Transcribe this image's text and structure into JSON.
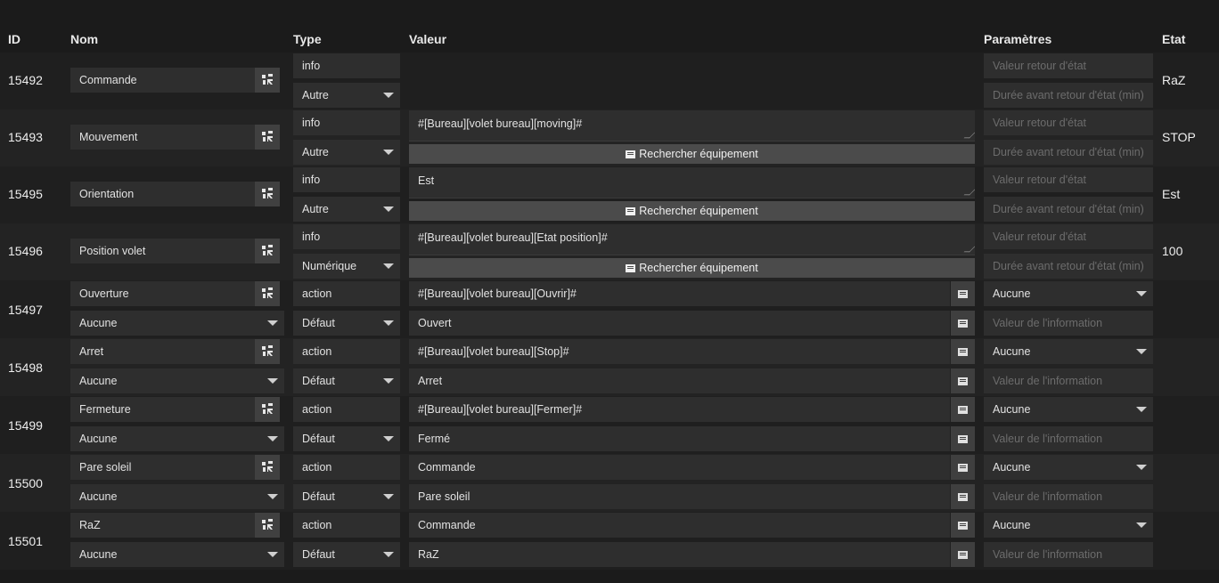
{
  "headers": {
    "id": "ID",
    "nom": "Nom",
    "type": "Type",
    "valeur": "Valeur",
    "parametres": "Paramètres",
    "etat": "Etat"
  },
  "search_button_label": "Rechercher équipement",
  "info_rows": [
    {
      "id": "15492",
      "name": "Commande",
      "type": "info",
      "subtype": "Autre",
      "value": "",
      "show_value": false,
      "param1_placeholder": "Valeur retour d'état",
      "param2_placeholder": "Durée avant retour d'état (min)",
      "state": "RaZ"
    },
    {
      "id": "15493",
      "name": "Mouvement",
      "type": "info",
      "subtype": "Autre",
      "value": "#[Bureau][volet bureau][moving]#",
      "show_value": true,
      "param1_placeholder": "Valeur retour d'état",
      "param2_placeholder": "Durée avant retour d'état (min)",
      "state": "STOP"
    },
    {
      "id": "15495",
      "name": "Orientation",
      "type": "info",
      "subtype": "Autre",
      "value": "Est",
      "show_value": true,
      "param1_placeholder": "Valeur retour d'état",
      "param2_placeholder": "Durée avant retour d'état (min)",
      "state": "Est"
    },
    {
      "id": "15496",
      "name": "Position volet",
      "type": "info",
      "subtype": "Numérique",
      "value": "#[Bureau][volet bureau][Etat position]#",
      "show_value": true,
      "param1_placeholder": "Valeur retour d'état",
      "param2_placeholder": "Durée avant retour d'état (min)",
      "state": "100"
    }
  ],
  "action_rows": [
    {
      "id": "15497",
      "name": "Ouverture",
      "name_select": "Aucune",
      "type": "action",
      "subtype": "Défaut",
      "value1": "#[Bureau][volet bureau][Ouvrir]#",
      "value2": "Ouvert",
      "param_select": "Aucune",
      "param_placeholder": "Valeur de l'information"
    },
    {
      "id": "15498",
      "name": "Arret",
      "name_select": "Aucune",
      "type": "action",
      "subtype": "Défaut",
      "value1": "#[Bureau][volet bureau][Stop]#",
      "value2": "Arret",
      "param_select": "Aucune",
      "param_placeholder": "Valeur de l'information"
    },
    {
      "id": "15499",
      "name": "Fermeture",
      "name_select": "Aucune",
      "type": "action",
      "subtype": "Défaut",
      "value1": "#[Bureau][volet bureau][Fermer]#",
      "value2": "Fermé",
      "param_select": "Aucune",
      "param_placeholder": "Valeur de l'information"
    },
    {
      "id": "15500",
      "name": "Pare soleil",
      "name_select": "Aucune",
      "type": "action",
      "subtype": "Défaut",
      "value1": "Commande",
      "value2": "Pare soleil",
      "param_select": "Aucune",
      "param_placeholder": "Valeur de l'information"
    },
    {
      "id": "15501",
      "name": "RaZ",
      "name_select": "Aucune",
      "type": "action",
      "subtype": "Défaut",
      "value1": "Commande",
      "value2": "RaZ",
      "param_select": "Aucune",
      "param_placeholder": "Valeur de l'information"
    }
  ]
}
